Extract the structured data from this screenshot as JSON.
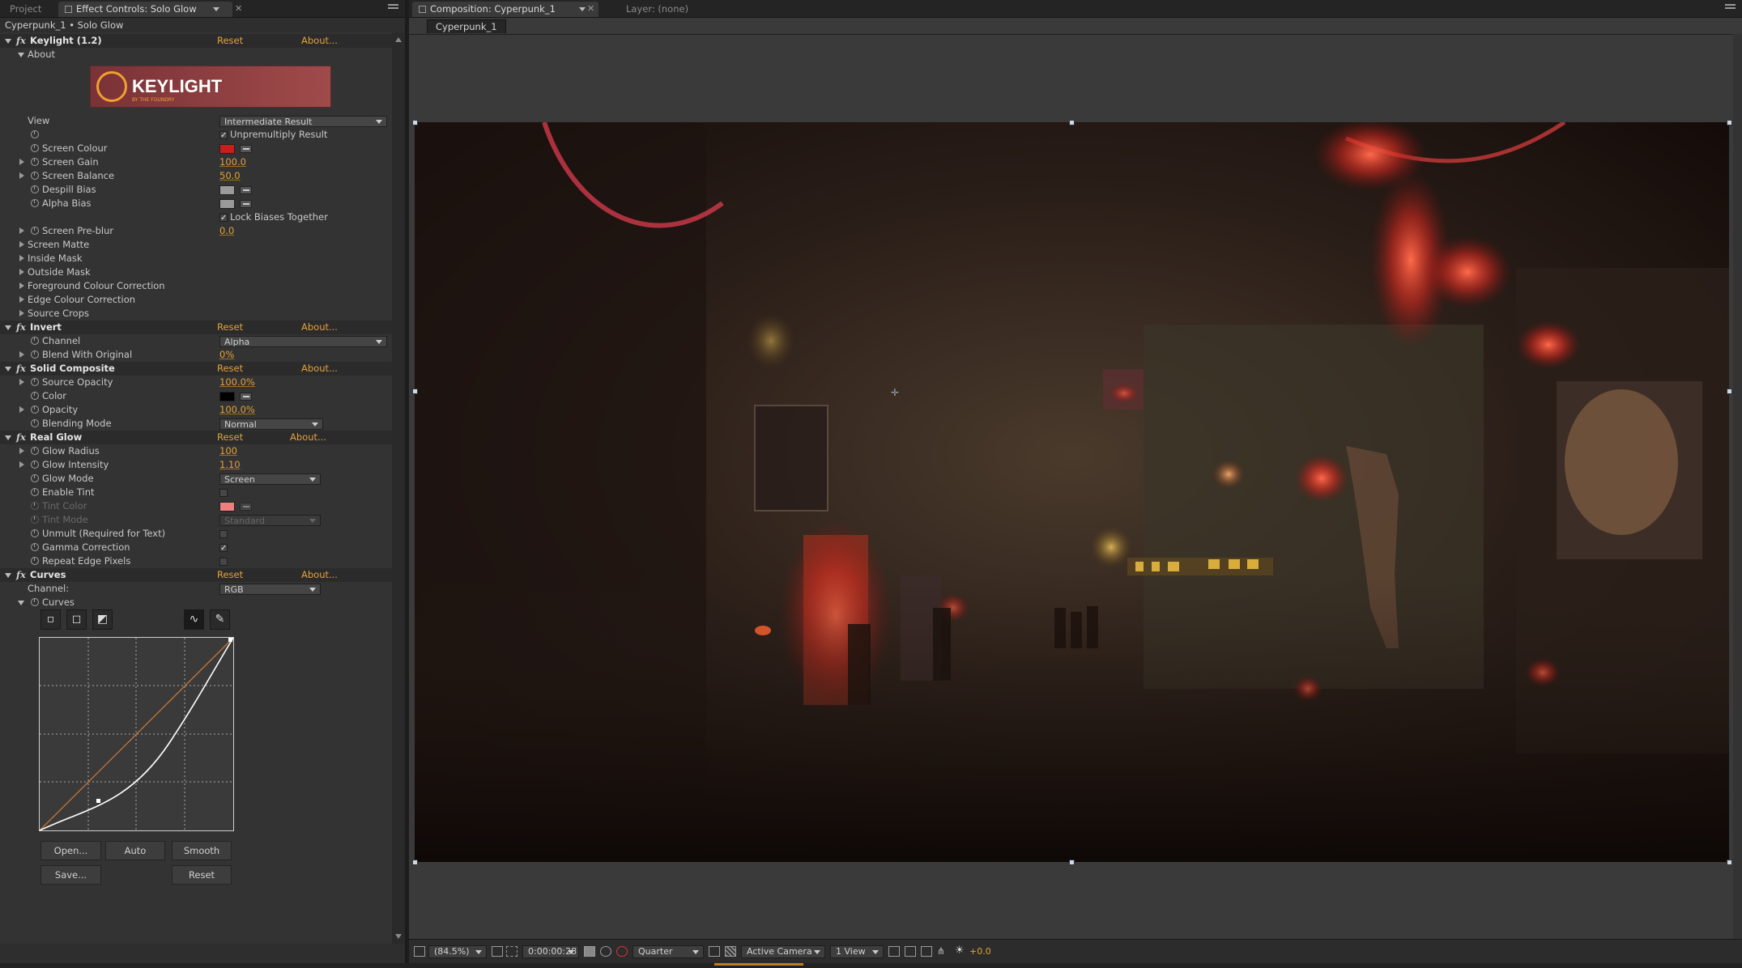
{
  "left_panel": {
    "tabs": {
      "project": "Project",
      "effect_controls": "Effect Controls: Solo Glow"
    },
    "breadcrumb": "Cyperpunk_1 • Solo Glow",
    "reset": "Reset",
    "about": "About...",
    "keylight": {
      "title": "Keylight (1.2)",
      "about_group": "About",
      "logo_text": "KEYLIGHT",
      "logo_sub": "BY THE FOUNDRY",
      "view_label": "View",
      "view_value": "Intermediate Result",
      "unpremultiply": "Unpremultiply Result",
      "screen_colour": "Screen Colour",
      "screen_colour_color": "#c81e1e",
      "screen_gain": "Screen Gain",
      "screen_gain_value": "100.0",
      "screen_balance": "Screen Balance",
      "screen_balance_value": "50.0",
      "despill_bias": "Despill Bias",
      "alpha_bias": "Alpha Bias",
      "lock_biases": "Lock Biases Together",
      "screen_preblur": "Screen Pre-blur",
      "screen_preblur_value": "0.0",
      "groups": [
        "Screen Matte",
        "Inside Mask",
        "Outside Mask",
        "Foreground Colour Correction",
        "Edge Colour Correction",
        "Source Crops"
      ]
    },
    "invert": {
      "title": "Invert",
      "channel": "Channel",
      "channel_value": "Alpha",
      "blend": "Blend With Original",
      "blend_value": "0%"
    },
    "solid_composite": {
      "title": "Solid Composite",
      "source_opacity": "Source Opacity",
      "source_opacity_value": "100.0%",
      "color": "Color",
      "color_value": "#000000",
      "opacity": "Opacity",
      "opacity_value": "100.0%",
      "blending_mode": "Blending Mode",
      "blending_mode_value": "Normal"
    },
    "real_glow": {
      "title": "Real Glow",
      "glow_radius": "Glow Radius",
      "glow_radius_value": "100",
      "glow_intensity": "Glow Intensity",
      "glow_intensity_value": "1.10",
      "glow_mode": "Glow Mode",
      "glow_mode_value": "Screen",
      "enable_tint": "Enable Tint",
      "tint_color": "Tint Color",
      "tint_color_value": "#f08080",
      "tint_mode": "Tint Mode",
      "tint_mode_value": "Standard",
      "unmult": "Unmult (Required for Text)",
      "gamma": "Gamma Correction",
      "repeat_edge": "Repeat Edge Pixels"
    },
    "curves": {
      "title": "Curves",
      "channel_label": "Channel:",
      "channel_value": "RGB",
      "curves_group": "Curves",
      "buttons": {
        "open": "Open...",
        "auto": "Auto",
        "smooth": "Smooth",
        "save": "Save...",
        "reset": "Reset"
      }
    }
  },
  "right_panel": {
    "tabs": {
      "composition": "Composition: Cyperpunk_1",
      "layer": "Layer: (none)"
    },
    "comp_tab": "Cyperpunk_1",
    "bottom": {
      "zoom": "(84.5%)",
      "timecode": "0:00:00:28",
      "resolution": "Quarter",
      "camera": "Active Camera",
      "views": "1 View",
      "exposure": "+0.0"
    }
  }
}
